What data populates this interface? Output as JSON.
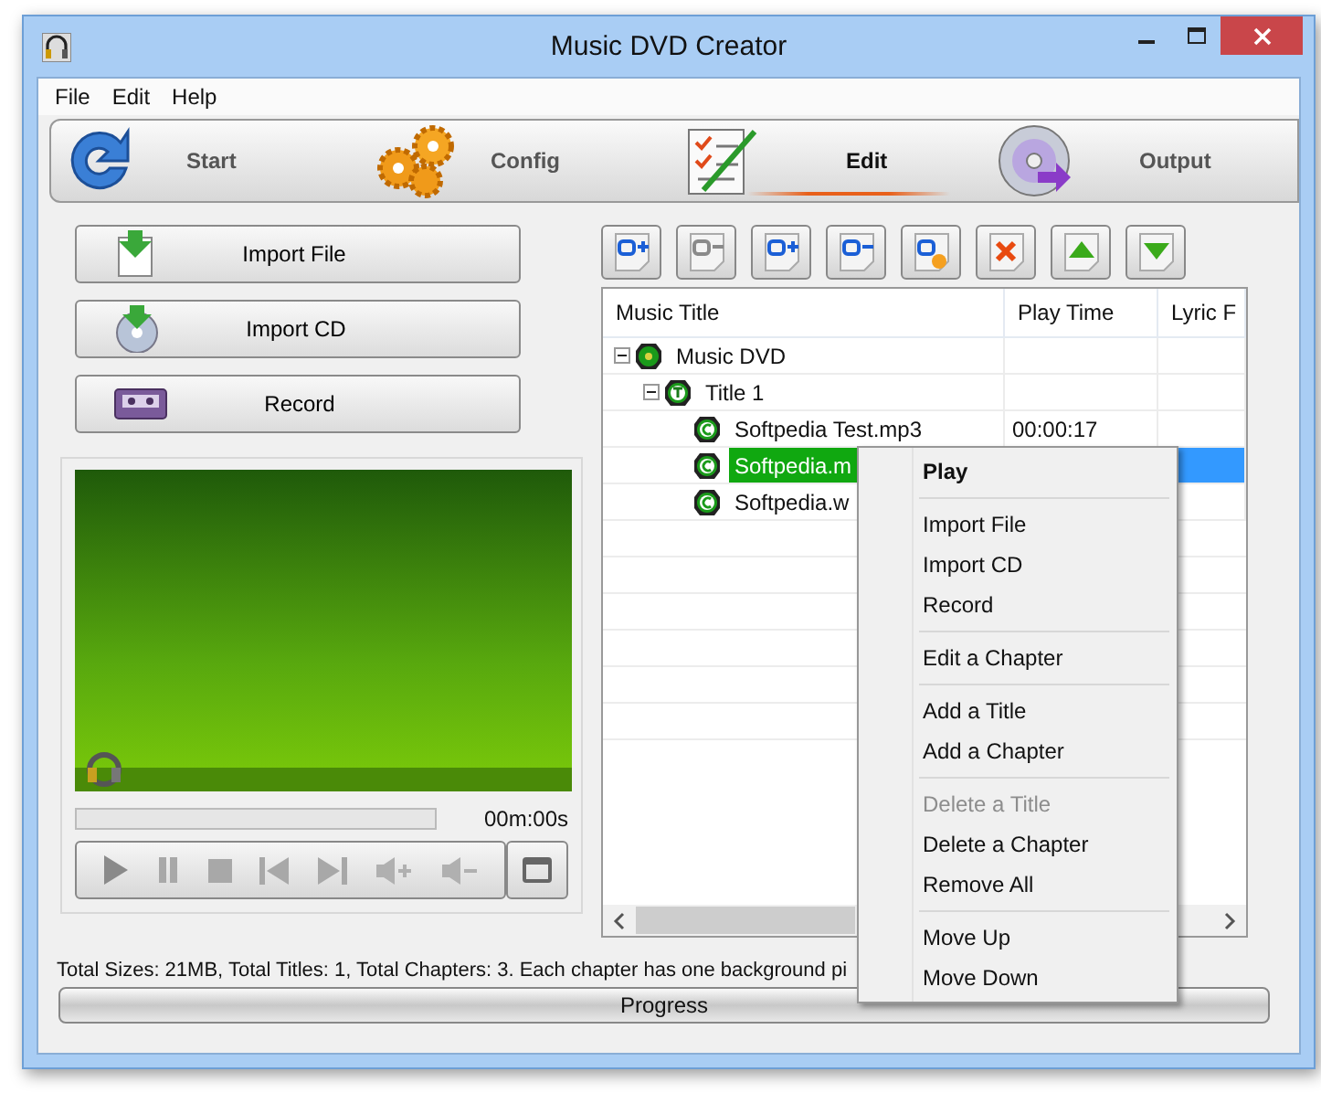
{
  "window": {
    "title": "Music DVD Creator"
  },
  "menu_bar": [
    "File",
    "Edit",
    "Help"
  ],
  "steps": [
    {
      "label": "Start",
      "kind": "start",
      "selected": false
    },
    {
      "label": "Config",
      "kind": "config",
      "selected": false
    },
    {
      "label": "Edit",
      "kind": "edit",
      "selected": true
    },
    {
      "label": "Output",
      "kind": "output",
      "selected": false
    }
  ],
  "import_buttons": [
    {
      "label": "Import File",
      "kind": "file"
    },
    {
      "label": "Import CD",
      "kind": "cd"
    },
    {
      "label": "Record",
      "kind": "record"
    }
  ],
  "player": {
    "position": {
      "level": 0
    },
    "time": "00m:00s"
  },
  "toolbar": [
    {
      "kind": "add-title"
    },
    {
      "kind": "remove-title"
    },
    {
      "kind": "add-chapter"
    },
    {
      "kind": "remove-chapter"
    },
    {
      "kind": "chapter-settings"
    },
    {
      "kind": "delete"
    },
    {
      "kind": "up"
    },
    {
      "kind": "down"
    }
  ],
  "table": {
    "columns": [
      "Music Title",
      "Play Time",
      "Lyric F"
    ],
    "rows": [
      {
        "title": "Music DVD",
        "kind": "disc",
        "expanded": true,
        "selected": false,
        "children": [
          {
            "title": "Title 1",
            "kind": "title",
            "expanded": true,
            "selected": false,
            "children": [
              {
                "title": "Softpedia Test.mp3",
                "kind": "chapter",
                "play_time": "00:00:17",
                "selected": false
              },
              {
                "title": "Softpedia.m",
                "kind": "chapter",
                "selected": true
              },
              {
                "title": "Softpedia.w",
                "kind": "chapter",
                "selected": false
              }
            ]
          }
        ]
      }
    ]
  },
  "status": "Total Sizes: 21MB, Total Titles: 1, Total Chapters: 3. Each chapter has one background pi",
  "progress": {
    "label": "Progress",
    "level": 0
  },
  "context_menu": [
    {
      "kind": "item",
      "label": "Play",
      "default": true,
      "disabled": false
    },
    {
      "kind": "separator"
    },
    {
      "kind": "item",
      "label": "Import File",
      "default": false,
      "disabled": false
    },
    {
      "kind": "item",
      "label": "Import CD",
      "default": false,
      "disabled": false
    },
    {
      "kind": "item",
      "label": "Record",
      "default": false,
      "disabled": false
    },
    {
      "kind": "separator"
    },
    {
      "kind": "item",
      "label": "Edit a Chapter",
      "default": false,
      "disabled": false
    },
    {
      "kind": "separator"
    },
    {
      "kind": "item",
      "label": "Add a Title",
      "default": false,
      "disabled": false
    },
    {
      "kind": "item",
      "label": "Add a Chapter",
      "default": false,
      "disabled": false
    },
    {
      "kind": "separator"
    },
    {
      "kind": "item",
      "label": "Delete a Title",
      "default": false,
      "disabled": true
    },
    {
      "kind": "item",
      "label": "Delete a Chapter",
      "default": false,
      "disabled": false
    },
    {
      "kind": "item",
      "label": "Remove All",
      "default": false,
      "disabled": false
    },
    {
      "kind": "separator"
    },
    {
      "kind": "item",
      "label": "Move Up",
      "default": false,
      "disabled": false
    },
    {
      "kind": "item",
      "label": "Move Down",
      "default": false,
      "disabled": false
    }
  ]
}
